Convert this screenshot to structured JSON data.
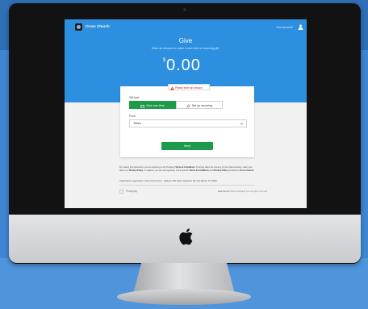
{
  "brand": {
    "name": "Cross Church"
  },
  "nav": {
    "account_label": "Your Account"
  },
  "give": {
    "title": "Give",
    "subtitle": "Enter an amount to make a one-time or recurring gift.",
    "currency_symbol": "$",
    "amount": "0.00",
    "error_message": "Please enter an amount"
  },
  "form": {
    "gift_type_label": "Gift type",
    "gift_type_options": [
      "Give one time",
      "Set up recurring"
    ],
    "fund_label": "Fund",
    "fund_value": "Tithes",
    "next_label": "Next"
  },
  "legal": {
    "text1": "By making this transaction you are agreeing to the Pushpay",
    "terms": "Terms & Conditions",
    "text2": ". Pushpay takes the security of your data seriously, read more about our",
    "privacy": "Privacy Policy",
    "text3": ". In addition, you are also agreeing to the specific",
    "terms2": "Terms & Conditions",
    "text4": "and",
    "privacy2": "Privacy Policy",
    "text5": "provided by",
    "org_link": "Cross Church",
    "org_line": "Organization Legal Name: Cross Church (CC)  ·  Address: 901 West Capistrano Rd, Dos Mendi, TX 75048"
  },
  "footer": {
    "brand": "Pushpay",
    "help": "Help Center",
    "copyright": "©2014 Pushpay® Ltd. All rights reserved."
  },
  "colors": {
    "accent_blue": "#2d8fdf",
    "action_green": "#1e9b4a",
    "error_red": "#c62828"
  },
  "icons": [
    "apple-logo-icon",
    "user-icon",
    "warning-icon",
    "gift-icon",
    "recurring-icon",
    "chevron-down-icon"
  ]
}
